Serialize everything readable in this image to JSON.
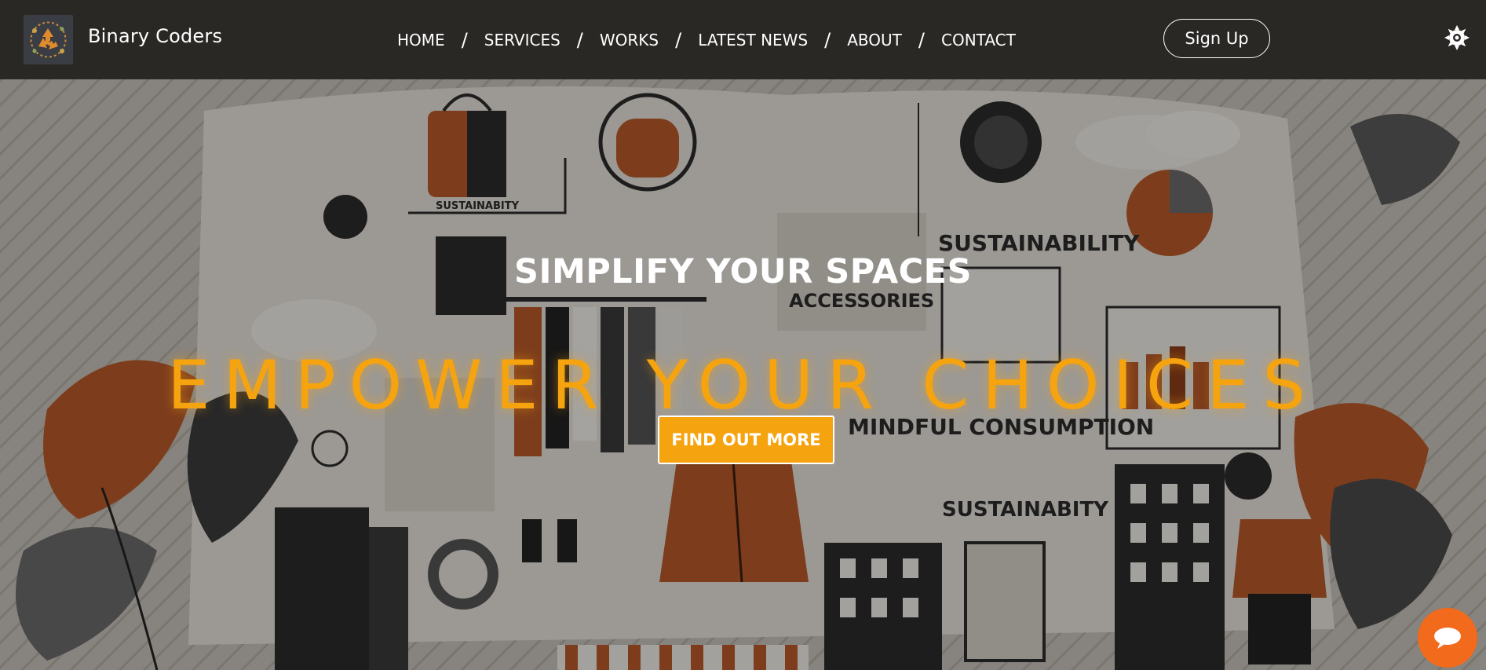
{
  "brand": {
    "name": "Binary Coders",
    "logo_icon": "recycle-logo-icon"
  },
  "nav": {
    "items": [
      {
        "label": "HOME"
      },
      {
        "label": "SERVICES"
      },
      {
        "label": "WORKS"
      },
      {
        "label": "LATEST NEWS"
      },
      {
        "label": "ABOUT"
      },
      {
        "label": "CONTACT"
      }
    ],
    "separator": "/"
  },
  "header": {
    "signup_label": "Sign Up",
    "theme_icon": "sun-icon"
  },
  "hero": {
    "subheading": "SIMPLIFY YOUR SPACES",
    "headline": "EMPOWER YOUR CHOICES",
    "cta_label": "FIND OUT MORE",
    "background_words": [
      "SUSTAINABITY",
      "SUSTAINABILITY",
      "ACCESSORIES",
      "MINDFUL CONSUMPTION",
      "SUSTAINABITY"
    ]
  },
  "chat": {
    "icon": "chat-bubble-icon"
  },
  "colors": {
    "accent": "#f6a310",
    "navbar": "#2a2825",
    "chat_button": "#f26a1b",
    "rust": "#b85a2a"
  }
}
